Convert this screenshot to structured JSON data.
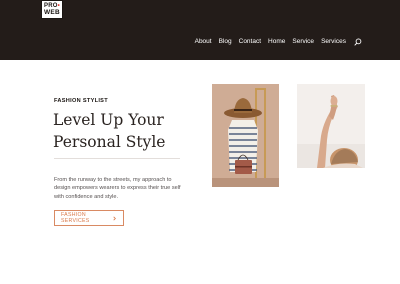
{
  "logo": {
    "line1_left": "PRO",
    "line1_right": "•",
    "line2": "WEB"
  },
  "nav": {
    "items": [
      "About",
      "Blog",
      "Contact",
      "Home",
      "Service",
      "Services"
    ],
    "search_icon": "search-icon"
  },
  "hero": {
    "eyebrow": "FASHION STYLIST",
    "headline_line1": "Level Up Your",
    "headline_line2": "Personal Style",
    "body": "From the runway to the streets, my approach to design empowers wearers to express their true self with confidence and style.",
    "cta_label": "FASHION SERVICES",
    "cta_icon": "chevron-right-icon"
  },
  "colors": {
    "header_bg": "#231c19",
    "accent": "#d97a4b",
    "text_dark": "#2a2320"
  }
}
